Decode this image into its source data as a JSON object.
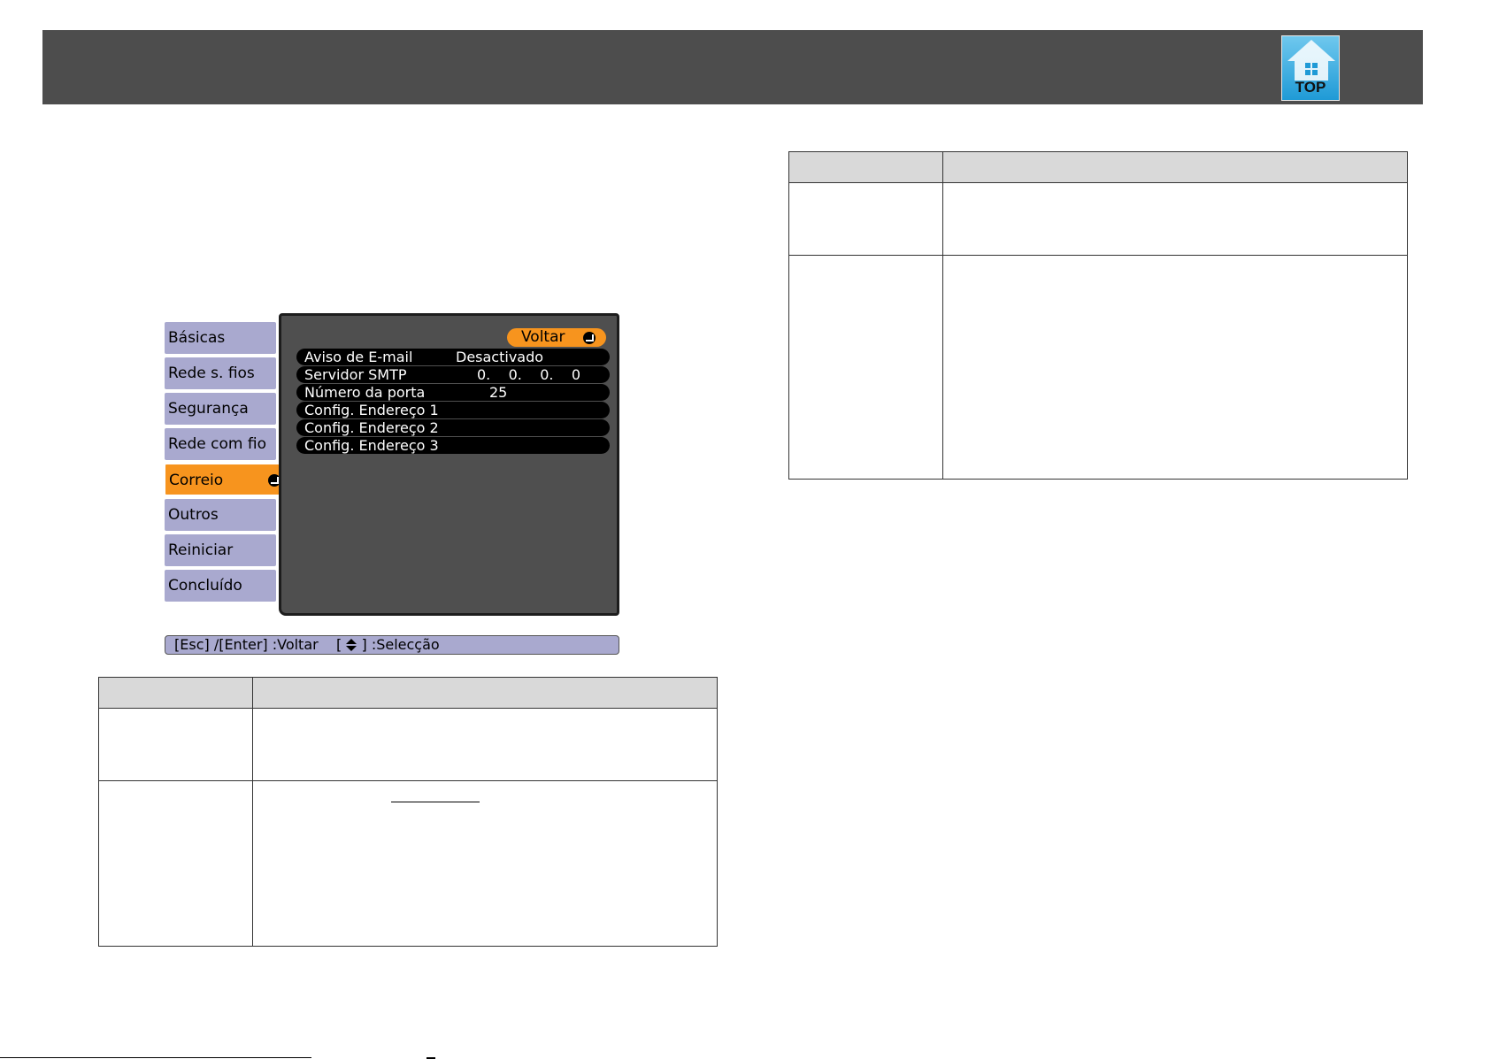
{
  "header": {
    "top_button_label": "TOP",
    "top_icon": "house-icon"
  },
  "projector_menu": {
    "sidebar": [
      {
        "label": "Básicas",
        "active": false
      },
      {
        "label": "Rede s. fios",
        "active": false
      },
      {
        "label": "Segurança",
        "active": false
      },
      {
        "label": "Rede com fio",
        "active": false
      },
      {
        "label": "Correio",
        "active": true
      },
      {
        "label": "Outros",
        "active": false
      },
      {
        "label": "Reiniciar",
        "active": false
      },
      {
        "label": "Concluído",
        "active": false
      }
    ],
    "back_button": "Voltar",
    "rows": [
      {
        "label": "Aviso de E-mail",
        "value": "Desactivado"
      },
      {
        "label": "Servidor SMTP",
        "value": "0.    0.    0.    0"
      },
      {
        "label": "Número da porta",
        "value": "25"
      },
      {
        "label": "Config. Endereço 1",
        "value": ""
      },
      {
        "label": "Config. Endereço 2",
        "value": ""
      },
      {
        "label": "Config. Endereço 3",
        "value": ""
      }
    ],
    "status": {
      "left": "[Esc] /[Enter] :Voltar",
      "bracket_open": "[",
      "bracket_close": "] :Selecção"
    },
    "colors": {
      "active": "#f7941e",
      "sidebar": "#a9a9cf",
      "panel": "#4f4f4f"
    }
  }
}
